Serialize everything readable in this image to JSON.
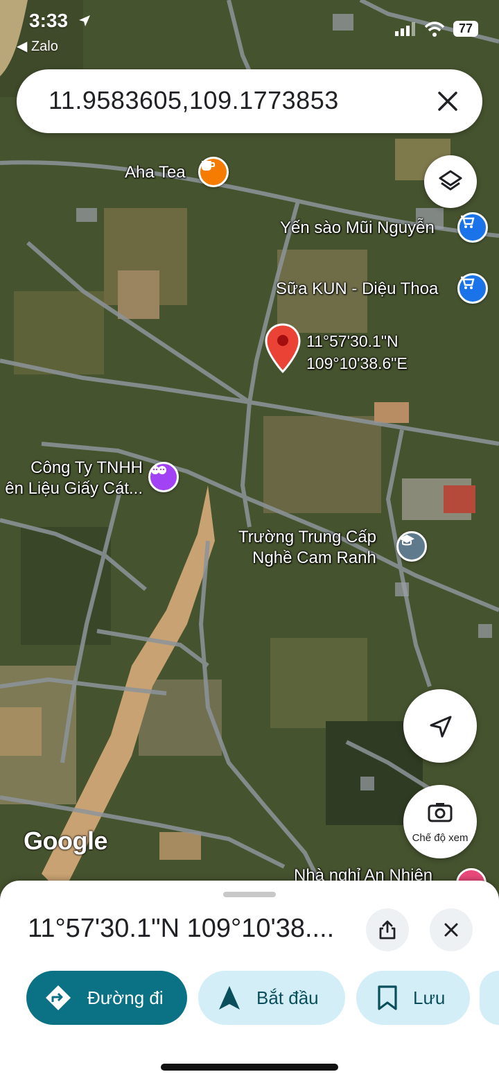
{
  "status_bar": {
    "time": "3:33",
    "back_app": "Zalo",
    "battery": "77"
  },
  "search": {
    "query": "11.9583605,109.1773853"
  },
  "map": {
    "dropped_pin": {
      "lat": "11°57'30.1\"N",
      "lng": "109°10'38.6\"E"
    },
    "pois": [
      {
        "name": "Aha Tea",
        "icon": "cafe-icon",
        "color": "#f57c00"
      },
      {
        "name": "Yến sào Mũi Nguyễn",
        "icon": "shopping-cart-icon",
        "color": "#1a73e8"
      },
      {
        "name": "Sữa KUN - Diệu Thoa",
        "icon": "shopping-cart-icon",
        "color": "#1a73e8"
      },
      {
        "name_line1": "Công Ty TNHH",
        "name_line2": "ên Liệu Giấy Cát...",
        "icon": "theater-icon",
        "color": "#a142f4"
      },
      {
        "name_line1": "Trường Trung Cấp",
        "name_line2": "Nghề Cam Ranh",
        "icon": "school-icon",
        "color": "#5f7a8c"
      },
      {
        "name": "Nhà nghỉ An Nhiên",
        "icon": "hotel-icon",
        "color": "#e8497a"
      }
    ],
    "watermark": "Google",
    "street_view_label": "Chế độ xem"
  },
  "sheet": {
    "title": "11°57'30.1\"N 109°10'38....",
    "actions": {
      "directions": "Đường đi",
      "start": "Bắt đầu",
      "save": "Lưu"
    }
  },
  "colors": {
    "accent": "#0b7285",
    "pill_bg": "#d3eef6",
    "pin_red": "#ea4335"
  }
}
